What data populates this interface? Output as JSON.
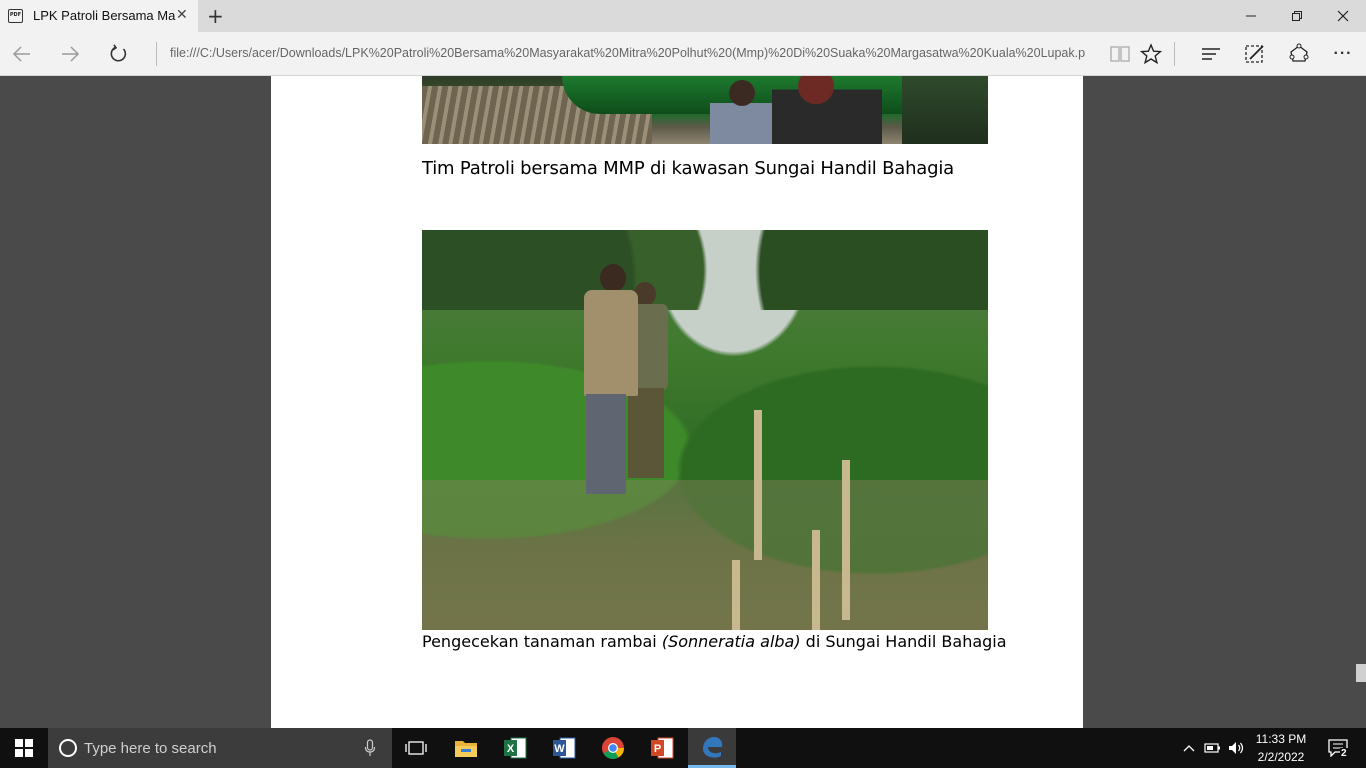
{
  "browser": {
    "tab_title": "LPK Patroli Bersama Ma",
    "tab_icon_label": "PDF",
    "address": "file:///C:/Users/acer/Downloads/LPK%20Patroli%20Bersama%20Masyarakat%20Mitra%20Polhut%20(Mmp)%20Di%20Suaka%20Margasatwa%20Kuala%20Lupak.p",
    "icons": [
      "pdf-icon",
      "close-icon",
      "plus-icon",
      "minimize-icon",
      "restore-icon",
      "close-window-icon",
      "back-icon",
      "forward-icon",
      "refresh-icon",
      "reading-view-icon",
      "star-icon",
      "hub-icon",
      "web-note-icon",
      "share-icon",
      "more-icon"
    ],
    "more_label": "···"
  },
  "document": {
    "caption1": "Tim Patroli bersama MMP di kawasan Sungai Handil Bahagia",
    "caption2_pre": "Pengecekan tanaman rambai ",
    "caption2_sci": "(Sonneratia alba)",
    "caption2_post": " di Sungai Handil Bahagia"
  },
  "taskbar": {
    "search_placeholder": "Type here to search",
    "apps": [
      "task-view-icon",
      "file-explorer-icon",
      "excel-icon",
      "word-icon",
      "chrome-icon",
      "powerpoint-icon",
      "edge-icon"
    ],
    "clock_time": "11:33 PM",
    "clock_date": "2/2/2022",
    "notification_count": "2"
  },
  "colors": {
    "page_bg": "#4a4a4a",
    "tab_active": "#f2f2f2",
    "taskbar": "#101010",
    "edge_accent": "#76b9ed"
  }
}
